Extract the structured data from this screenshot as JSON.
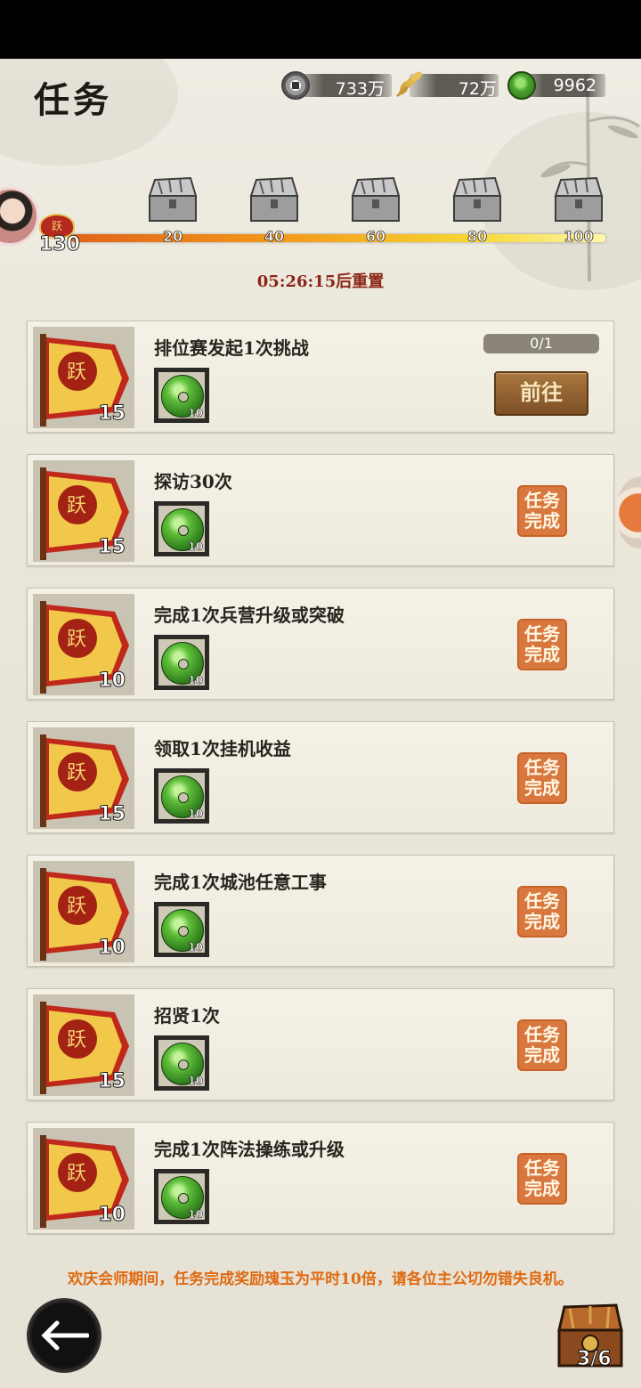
{
  "header": {
    "title": "任务",
    "resources": [
      {
        "icon": "copper-coin-icon",
        "value": "733万"
      },
      {
        "icon": "grain-icon",
        "value": "72万"
      },
      {
        "icon": "jade-icon",
        "value": "9962"
      }
    ]
  },
  "activity": {
    "current": "130",
    "badge_char": "跃",
    "milestones": [
      "20",
      "40",
      "60",
      "80",
      "100"
    ],
    "reset_text": "05:26:15后重置"
  },
  "tasks": [
    {
      "name": "排位赛发起1次挑战",
      "points": "15",
      "reward_count": "10",
      "progress": "0/1",
      "action": "前往",
      "status": "in-progress"
    },
    {
      "name": "探访30次",
      "points": "15",
      "reward_count": "10",
      "status_label": "任务\n完成",
      "status": "done"
    },
    {
      "name": "完成1次兵营升级或突破",
      "points": "10",
      "reward_count": "10",
      "status_label": "任务\n完成",
      "status": "done"
    },
    {
      "name": "领取1次挂机收益",
      "points": "15",
      "reward_count": "10",
      "status_label": "任务\n完成",
      "status": "done"
    },
    {
      "name": "完成1次城池任意工事",
      "points": "10",
      "reward_count": "10",
      "status_label": "任务\n完成",
      "status": "done"
    },
    {
      "name": "招贤1次",
      "points": "15",
      "reward_count": "10",
      "status_label": "任务\n完成",
      "status": "done"
    },
    {
      "name": "完成1次阵法操练或升级",
      "points": "10",
      "reward_count": "10",
      "status_label": "任务\n完成",
      "status": "done"
    }
  ],
  "footer": {
    "notice": "欢庆会师期间，任务完成奖励瑰玉为平时10倍，请各位主公切勿错失良机。",
    "chest_progress": "3/6"
  },
  "colors": {
    "accent_orange": "#d9783e",
    "reset_red": "#8b2617",
    "notice_orange": "#e06a12"
  }
}
